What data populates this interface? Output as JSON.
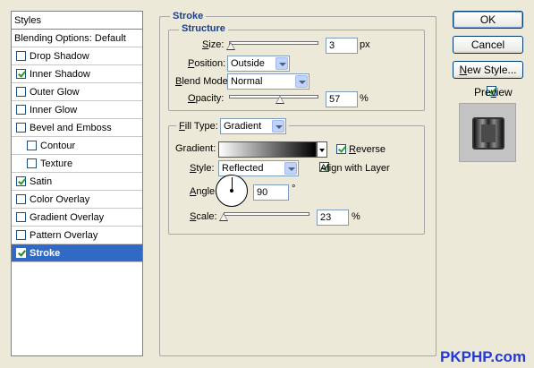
{
  "styles_panel": {
    "header": "Styles",
    "items": [
      {
        "label": "Blending Options: Default",
        "checkbox": false,
        "checked": false,
        "indent": false,
        "selected": false
      },
      {
        "label": "Drop Shadow",
        "checkbox": true,
        "checked": false,
        "indent": false,
        "selected": false
      },
      {
        "label": "Inner Shadow",
        "checkbox": true,
        "checked": true,
        "indent": false,
        "selected": false
      },
      {
        "label": "Outer Glow",
        "checkbox": true,
        "checked": false,
        "indent": false,
        "selected": false
      },
      {
        "label": "Inner Glow",
        "checkbox": true,
        "checked": false,
        "indent": false,
        "selected": false
      },
      {
        "label": "Bevel and Emboss",
        "checkbox": true,
        "checked": false,
        "indent": false,
        "selected": false
      },
      {
        "label": "Contour",
        "checkbox": true,
        "checked": false,
        "indent": true,
        "selected": false
      },
      {
        "label": "Texture",
        "checkbox": true,
        "checked": false,
        "indent": true,
        "selected": false
      },
      {
        "label": "Satin",
        "checkbox": true,
        "checked": true,
        "indent": false,
        "selected": false
      },
      {
        "label": "Color Overlay",
        "checkbox": true,
        "checked": false,
        "indent": false,
        "selected": false
      },
      {
        "label": "Gradient Overlay",
        "checkbox": true,
        "checked": false,
        "indent": false,
        "selected": false
      },
      {
        "label": "Pattern Overlay",
        "checkbox": true,
        "checked": false,
        "indent": false,
        "selected": false
      },
      {
        "label": "Stroke",
        "checkbox": true,
        "checked": true,
        "indent": false,
        "selected": true
      }
    ]
  },
  "stroke": {
    "title": "Stroke",
    "structure": {
      "title": "Structure",
      "size_label": "Size:",
      "size_value": "3",
      "size_unit": "px",
      "size_slider_fraction": 0.02,
      "position_label": "Position:",
      "position_value": "Outside",
      "blend_mode_label": "Blend Mode:",
      "blend_mode_value": "Normal",
      "opacity_label": "Opacity:",
      "opacity_value": "57",
      "opacity_unit": "%",
      "opacity_slider_fraction": 0.57
    },
    "fill": {
      "fill_type_label": "Fill Type:",
      "fill_type_value": "Gradient",
      "gradient_label": "Gradient:",
      "reverse_label": "Reverse",
      "reverse_checked": true,
      "style_label": "Style:",
      "style_value": "Reflected",
      "align_label": "Align with Layer",
      "align_checked": true,
      "angle_label": "Angle:",
      "angle_value": "90",
      "angle_unit": "°",
      "scale_label": "Scale:",
      "scale_value": "23",
      "scale_unit": "%",
      "scale_slider_fraction": 0.0
    }
  },
  "buttons": {
    "ok": "OK",
    "cancel": "Cancel",
    "new_style": "New Style..."
  },
  "preview": {
    "label": "Preview",
    "checked": true
  },
  "watermark": "PKPHP.com",
  "colors": {
    "dialog_bg": "#ece9d8",
    "selection": "#316ac5",
    "group_title": "#1a3e8c",
    "watermark": "#2338d6"
  }
}
